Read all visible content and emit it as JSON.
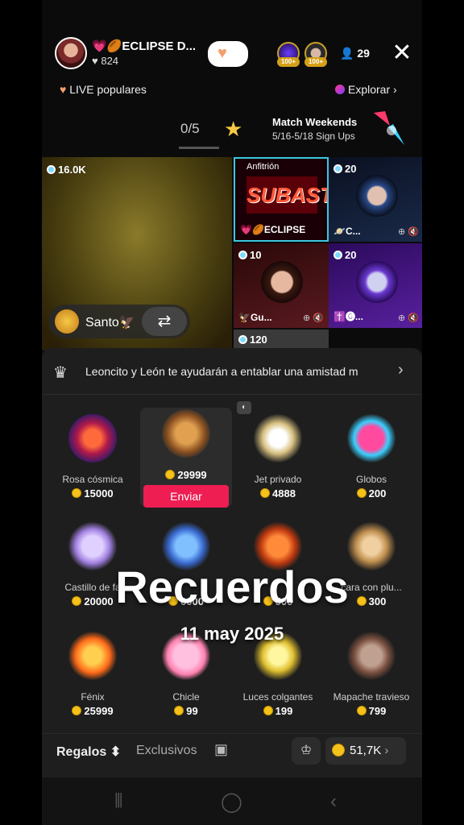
{
  "header": {
    "host_name": "💗🏉ECLIPSE D...",
    "host_likes": "824",
    "follow_icon": "heart-icon",
    "viewer_badges": [
      "100+",
      "100+"
    ],
    "viewer_count": "29",
    "close_glyph": "✕"
  },
  "nav": {
    "live_popular": "LIVE populares",
    "explore": "Explorar"
  },
  "match": {
    "count": "0/5",
    "title": "Match Weekends",
    "subtitle": "5/16-5/18 Sign Ups"
  },
  "grid": {
    "main_gems": "16.0K",
    "santo_name": "Santo🦅",
    "tiles": [
      {
        "gems": "",
        "label_top": "Anfitrión",
        "poster": "SUBASTA",
        "name": "💗🏉ECLIPSE"
      },
      {
        "gems": "20",
        "name": "🪐C..."
      },
      {
        "gems": "10",
        "name": "🦅Gu..."
      },
      {
        "gems": "20",
        "name": "✝️🅖..."
      },
      {
        "gems": "120",
        "name": ""
      }
    ]
  },
  "panel": {
    "banner_text": "Leoncito y León te ayudarán a entablar una amistad m",
    "send_label": "Enviar",
    "gifts": [
      {
        "name": "Rosa cósmica",
        "price": "15000"
      },
      {
        "name": "",
        "price": "29999"
      },
      {
        "name": "Jet privado",
        "price": "4888"
      },
      {
        "name": "Globos",
        "price": "200"
      },
      {
        "name": "Castillo de fa",
        "price": "20000"
      },
      {
        "name": "",
        "price": "6000"
      },
      {
        "name": "",
        "price": "500"
      },
      {
        "name": "cara con plu...",
        "price": "300"
      },
      {
        "name": "Fénix",
        "price": "25999"
      },
      {
        "name": "Chicle",
        "price": "99"
      },
      {
        "name": "Luces colgantes",
        "price": "199"
      },
      {
        "name": "Mapache travieso",
        "price": "799"
      }
    ],
    "tabs": {
      "regalos": "Regalos ⬍",
      "exclusivos": "Exclusivos"
    },
    "balance": "51,7K"
  },
  "overlay": {
    "title": "Recuerdos",
    "date": "11 may 2025"
  },
  "colors": {
    "accent": "#ee1d52",
    "coin": "#f4c21a",
    "gem": "#7fd9ff"
  }
}
